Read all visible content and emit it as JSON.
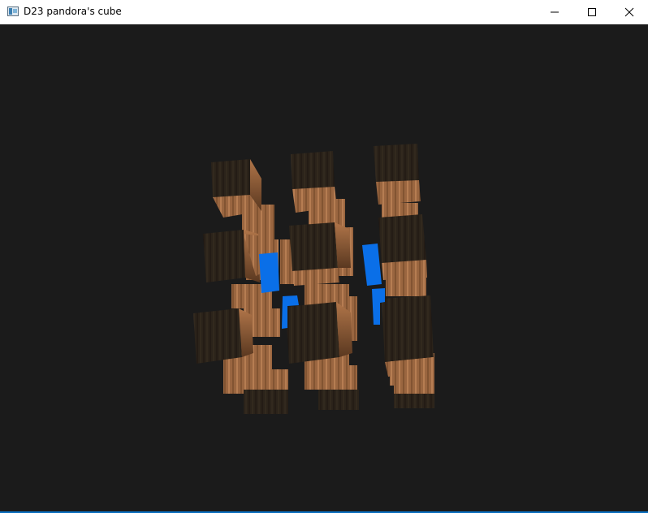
{
  "window": {
    "title": "D23 pandora's cube",
    "icon": "app-window-icon",
    "controls": [
      "minimize-icon",
      "maximize-icon",
      "close-icon"
    ]
  },
  "scene": {
    "description_colors": {
      "background": "#1b1b1b",
      "crate_dark": "#2a2219",
      "crate_light": "#a06a44",
      "accent_blue": "#0a6fe8"
    }
  }
}
